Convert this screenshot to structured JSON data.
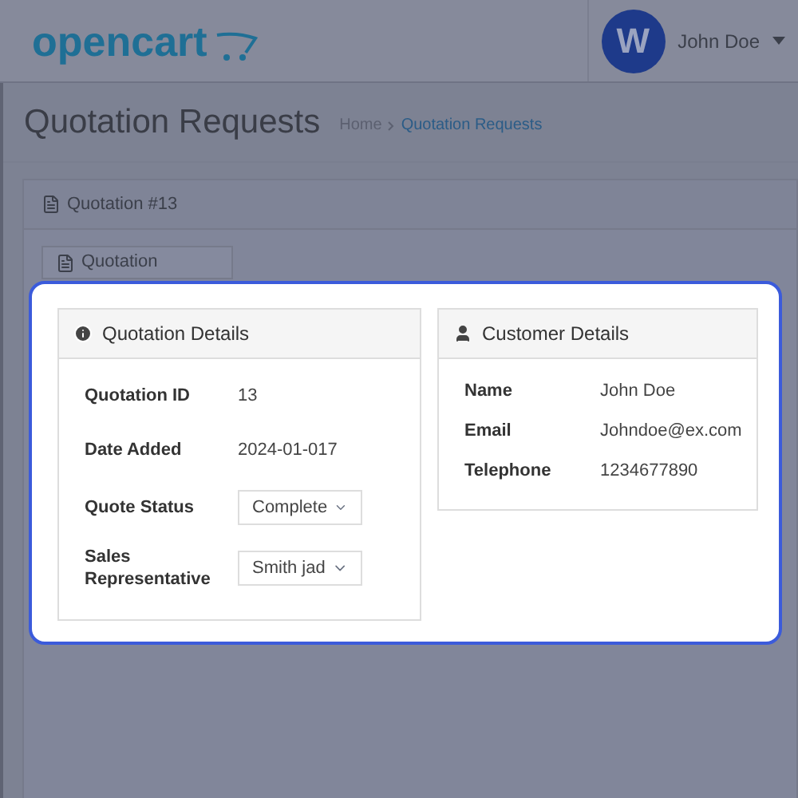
{
  "header": {
    "logo": "opencart",
    "avatar_letter": "W",
    "user": "John Doe"
  },
  "page": {
    "title": "Quotation Requests",
    "breadcrumbs": [
      {
        "label": "Home",
        "selected": false
      },
      {
        "label": "Quotation Requests",
        "selected": true
      }
    ]
  },
  "panel": {
    "title": "Quotation #13",
    "tabs": [
      {
        "label": "Quotation",
        "selected": true
      }
    ]
  },
  "quotation_details": {
    "title": "Quotation Details",
    "rows": [
      {
        "kind": "text",
        "label": "Quotation ID",
        "value": "13"
      },
      {
        "kind": "text",
        "label": "Date Added",
        "value": "2024-01-017"
      },
      {
        "kind": "select",
        "label": "Quote Status",
        "value": "Complete"
      },
      {
        "kind": "select",
        "label": "Sales Representative",
        "value": "Smith jad"
      }
    ]
  },
  "customer_details": {
    "title": "Customer Details",
    "rows": [
      {
        "label": "Name",
        "value": "John Doe"
      },
      {
        "label": "Email",
        "value": "Johndoe@ex.com"
      },
      {
        "label": "Telephone",
        "value": "1234677890"
      }
    ]
  }
}
